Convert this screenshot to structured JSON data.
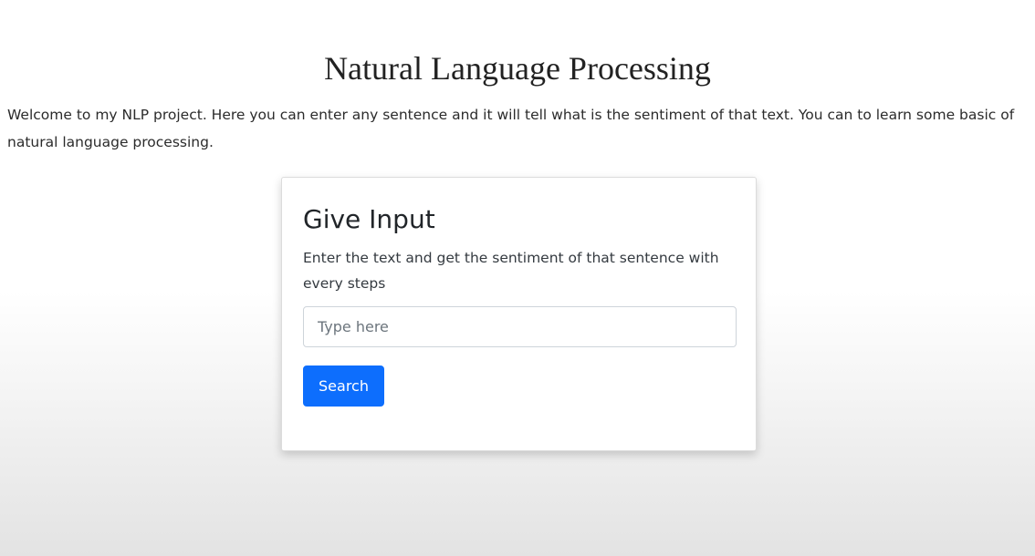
{
  "header": {
    "title": "Natural Language Processing"
  },
  "intro": {
    "text": "Welcome to my NLP project. Here you can enter any sentence and it will tell what is the sentiment of that text. You can to learn some basic of natural language processing."
  },
  "card": {
    "title": "Give Input",
    "description": "Enter the text and get the sentiment of that sentence with every steps",
    "input": {
      "value": "",
      "placeholder": "Type here"
    },
    "button_label": "Search"
  },
  "colors": {
    "button_primary": "#0d6efd",
    "text_main": "#212529"
  }
}
